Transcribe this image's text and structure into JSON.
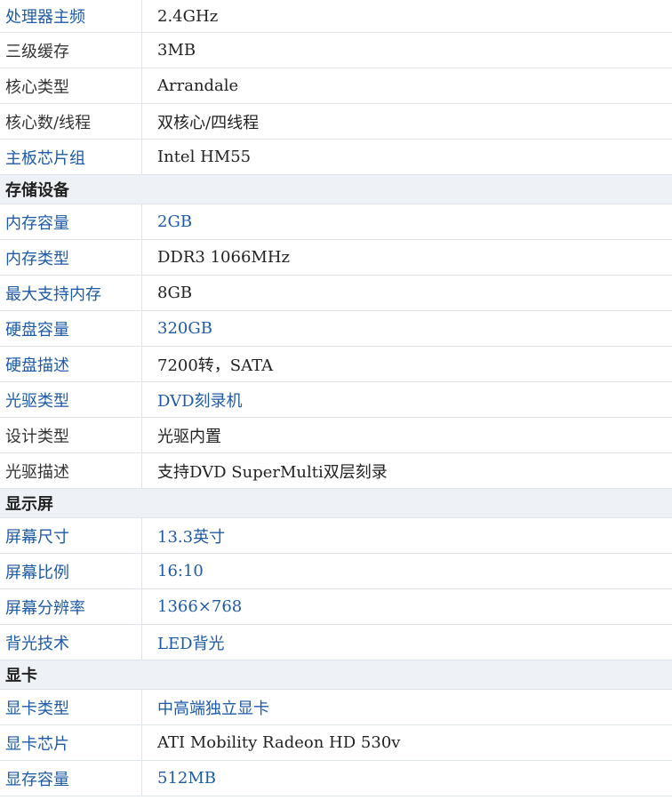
{
  "colors": {
    "link": "#1d5aa8",
    "section_bg": "#eef2f6",
    "border": "#dfe4ea"
  },
  "rows": [
    {
      "label": "处理器主频",
      "value": "2.4GHz"
    },
    {
      "label": "三级缓存",
      "value": "3MB"
    },
    {
      "label": "核心类型",
      "value": "Arrandale"
    },
    {
      "label": "核心数/线程",
      "value": "双核心/四线程"
    },
    {
      "label": "主板芯片组",
      "value": "Intel HM55"
    }
  ],
  "sections": {
    "storage": {
      "title": "存储设备",
      "rows": [
        {
          "label": "内存容量",
          "value": "2GB"
        },
        {
          "label": "内存类型",
          "value": "DDR3 1066MHz"
        },
        {
          "label": "最大支持内存",
          "value": "8GB"
        },
        {
          "label": "硬盘容量",
          "value": "320GB"
        },
        {
          "label": "硬盘描述",
          "value": "7200转，SATA"
        },
        {
          "label": "光驱类型",
          "value": "DVD刻录机"
        },
        {
          "label": "设计类型",
          "value": "光驱内置"
        },
        {
          "label": "光驱描述",
          "value": "支持DVD SuperMulti双层刻录"
        }
      ]
    },
    "display": {
      "title": "显示屏",
      "rows": [
        {
          "label": "屏幕尺寸",
          "value": "13.3英寸"
        },
        {
          "label": "屏幕比例",
          "value": "16:10"
        },
        {
          "label": "屏幕分辨率",
          "value": "1366×768"
        },
        {
          "label": "背光技术",
          "value": "LED背光"
        }
      ]
    },
    "graphics": {
      "title": "显卡",
      "rows": [
        {
          "label": "显卡类型",
          "value": "中高端独立显卡"
        },
        {
          "label": "显卡芯片",
          "value": "ATI Mobility Radeon HD 530v"
        },
        {
          "label": "显存容量",
          "value": "512MB"
        }
      ]
    }
  }
}
